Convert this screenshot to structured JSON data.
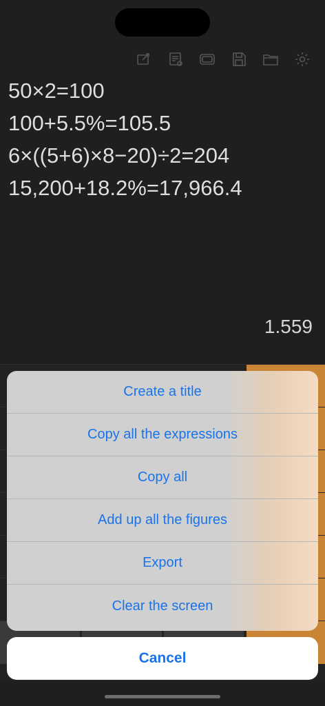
{
  "toolbar": {
    "icons": [
      "edit-icon",
      "receipt-icon",
      "tape-icon",
      "save-icon",
      "folder-icon",
      "gear-icon"
    ]
  },
  "expressions": [
    "50×2=100",
    "100+5.5%=105.5",
    "6×((5+6)×8−20)÷2=204",
    "15,200+18.2%=17,966.4"
  ],
  "display": {
    "result": "1.559"
  },
  "action_sheet": {
    "items": [
      "Create a title",
      "Copy all the expressions",
      "Copy all",
      "Add up all the figures",
      "Export",
      "Clear the screen"
    ],
    "cancel": "Cancel"
  },
  "colors": {
    "accent_blue": "#1a73e8",
    "orange_key": "#c98434",
    "background": "#1f1f1f"
  }
}
